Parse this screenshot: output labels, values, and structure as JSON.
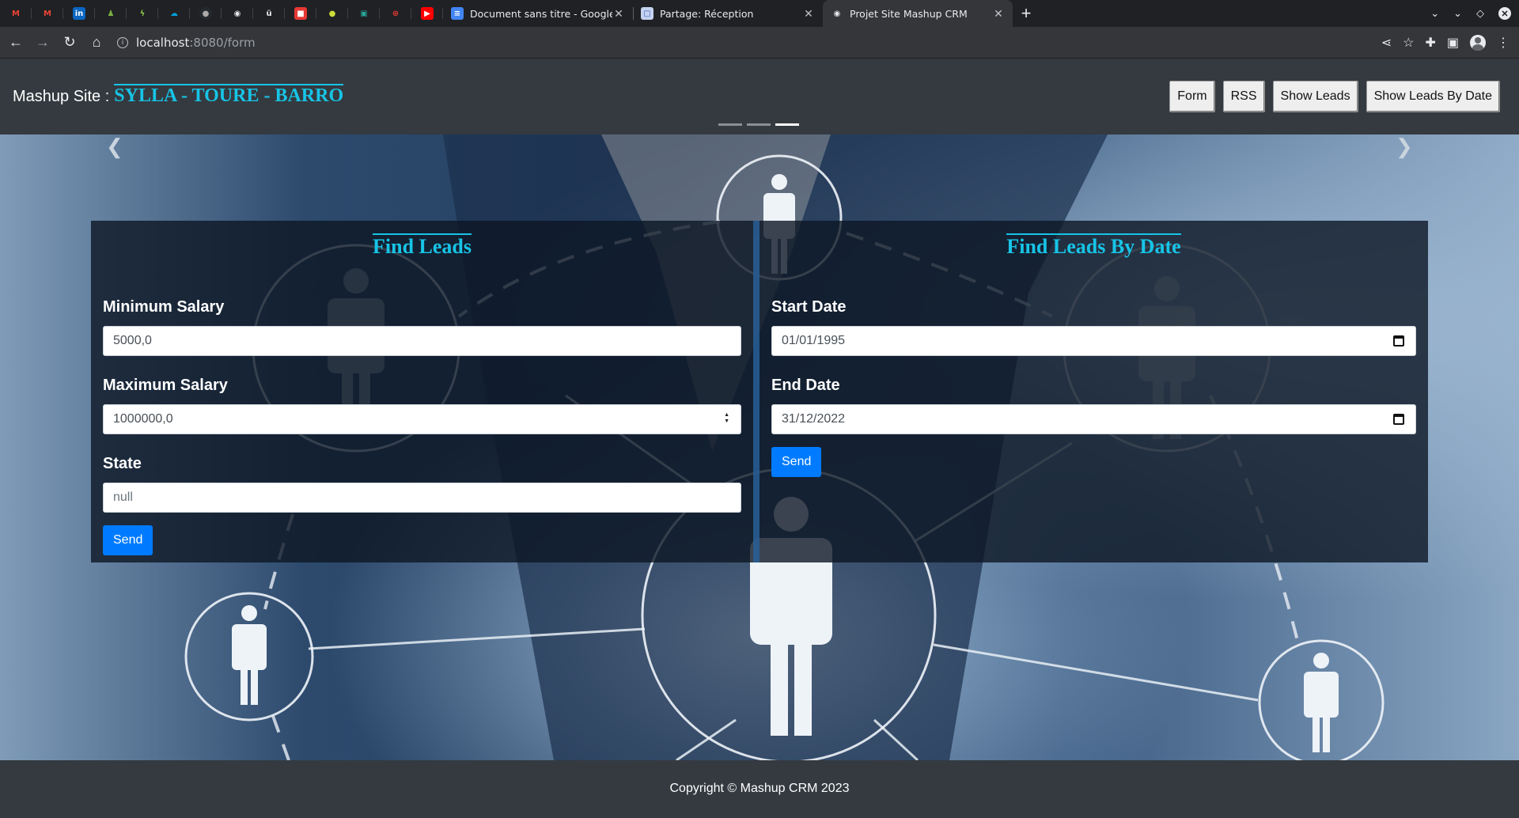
{
  "browser": {
    "tabs": [
      {
        "title": "Document sans titre - Google"
      },
      {
        "title": "Partage: Réception"
      },
      {
        "title": "Projet Site Mashup CRM"
      }
    ],
    "url_host": "localhost",
    "url_path": ":8080/form"
  },
  "header": {
    "brand_prefix": "Mashup Site :",
    "brand_names": "SYLLA - TOURE - BARRO",
    "nav": [
      "Form",
      "RSS",
      "Show Leads",
      "Show Leads By Date"
    ]
  },
  "find_leads": {
    "title": "Find Leads",
    "min_salary_label": "Minimum Salary",
    "min_salary_value": "5000,0",
    "max_salary_label": "Maximum Salary",
    "max_salary_value": "1000000,0",
    "state_label": "State",
    "state_placeholder": "null",
    "send_label": "Send"
  },
  "find_by_date": {
    "title": "Find Leads By Date",
    "start_label": "Start Date",
    "start_value": "01/01/1995",
    "end_label": "End Date",
    "end_value": "31/12/2022",
    "send_label": "Send"
  },
  "footer": {
    "text": "Copyright © Mashup CRM 2023"
  }
}
